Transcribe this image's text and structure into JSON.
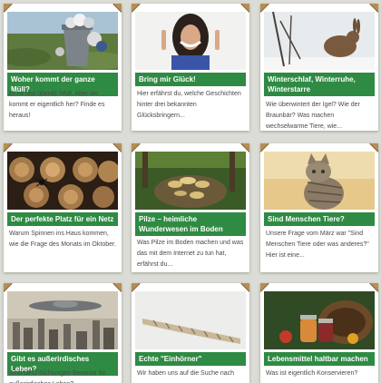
{
  "cards": [
    {
      "title": "Woher kommt der ganze Müll?",
      "teaser": "Er ist fast überall: Müll. Aber wo kommt er eigentlich her? Finde es heraus!",
      "image": "trash-can-photo"
    },
    {
      "title": "Bring mir Glück!",
      "teaser": "Hier erfährst du, welche Geschichten hinter drei bekannten Glücksbringern...",
      "image": "woman-crossed-fingers-photo"
    },
    {
      "title": "Winterschlaf, Winterruhe, Winterstarre",
      "teaser": "Wie überwintert der Igel? Wie der Braunbär? Was machen wechselwarme Tiere, wie...",
      "image": "hare-in-winter-photo"
    },
    {
      "title": "Der perfekte Platz für ein Netz",
      "teaser": "Warum Spinnen ins Haus kommen, wie die Frage des Monats im Oktober.",
      "image": "spider-on-logs-photo"
    },
    {
      "title": "Pilze – heimliche Wunderwesen im Boden",
      "teaser": "Was Pilze im Boden machen und was das mit dem Internet zu tun hat, erfährst du...",
      "image": "mushrooms-on-stump-photo"
    },
    {
      "title": "Sind Menschen Tiere?",
      "teaser": "Unsere Frage vom März war \"Sind Menschen Tiere oder was anderes?\" Hier ist eine...",
      "image": "cat-photo"
    },
    {
      "title": "Gibt es außerirdisches Leben?",
      "teaser": "Sind UFO-Sichtungen Beweise für außerirdisches Leben?",
      "image": "ufo-over-city-photo"
    },
    {
      "title": "Echte \"Einhörner\"",
      "teaser": "Wir haben uns auf die Suche nach",
      "image": "narwhal-tusk-photo"
    },
    {
      "title": "Lebensmittel haltbar machen",
      "teaser": "Was ist eigentlich Konservieren?",
      "image": "preserves-basket-photo"
    }
  ]
}
